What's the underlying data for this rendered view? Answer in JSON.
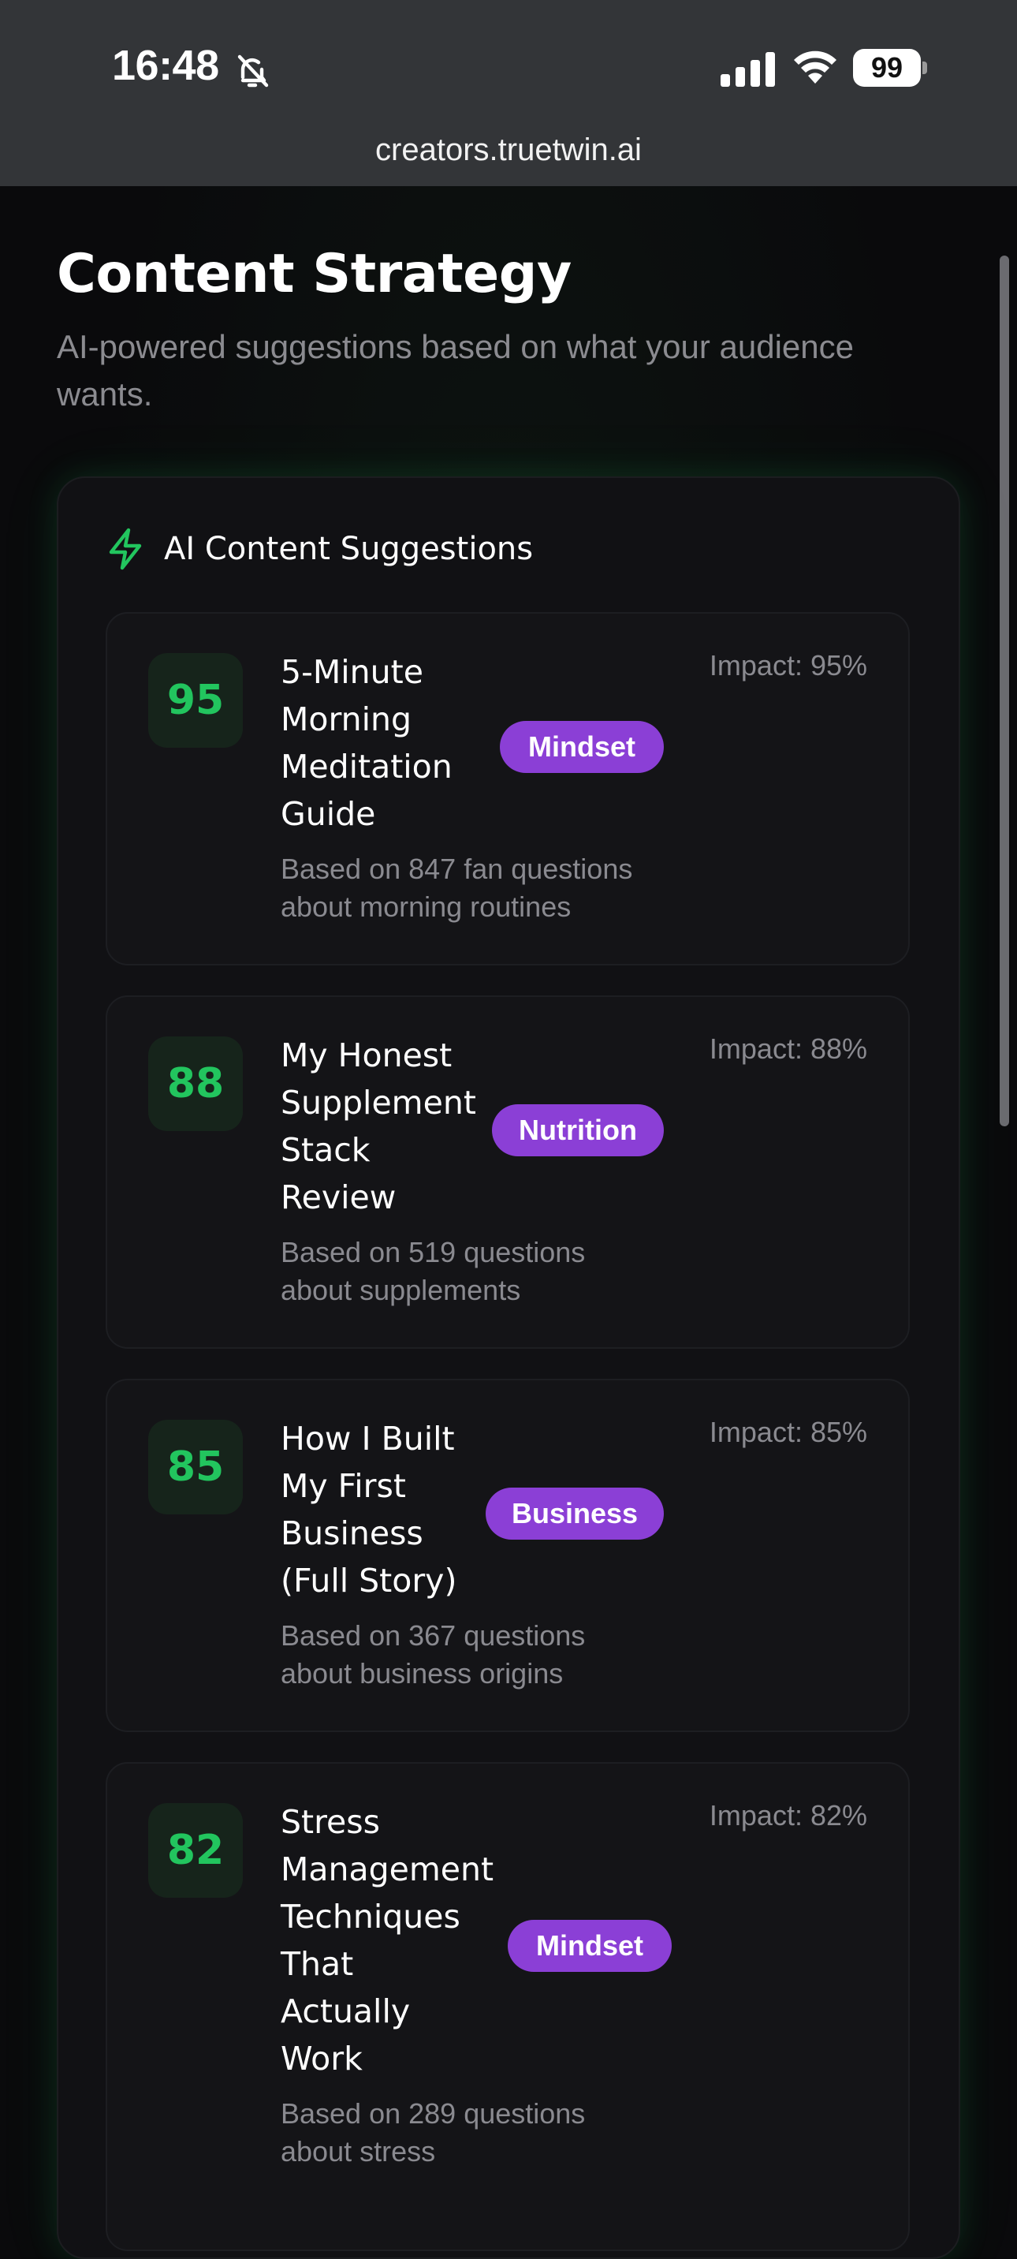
{
  "status_bar": {
    "time": "16:48",
    "battery": "99"
  },
  "browser": {
    "url": "creators.truetwin.ai"
  },
  "page": {
    "title": "Content Strategy",
    "subtitle": "AI-powered suggestions based on what your audience wants."
  },
  "panel": {
    "header": "AI Content Suggestions"
  },
  "suggestions": [
    {
      "score": "95",
      "title": "5-Minute\nMorning\nMeditation\nGuide",
      "tag": "Mindset",
      "impact": "Impact: 95%",
      "description": "Based on 847 fan questions\nabout morning routines"
    },
    {
      "score": "88",
      "title": "My Honest\nSupplement\nStack\nReview",
      "tag": "Nutrition",
      "impact": "Impact: 88%",
      "description": "Based on 519 questions\nabout supplements"
    },
    {
      "score": "85",
      "title": "How I Built\nMy First\nBusiness\n(Full Story)",
      "tag": "Business",
      "impact": "Impact: 85%",
      "description": "Based on 367 questions\nabout business origins"
    },
    {
      "score": "82",
      "title": "Stress\nManagement\nTechniques\nThat\nActually\nWork",
      "tag": "Mindset",
      "impact": "Impact: 82%",
      "description": "Based on 289 questions\nabout stress"
    }
  ],
  "colors": {
    "accent_green": "#22c55e",
    "tag_purple": "#8b3fd6",
    "background": "#0a0a0c",
    "card": "#141417"
  },
  "icons": {
    "silent": "bell-slash-icon",
    "signal": "cellular-signal-icon",
    "wifi": "wifi-icon",
    "battery": "battery-icon",
    "panel": "lightning-bolt-icon"
  }
}
